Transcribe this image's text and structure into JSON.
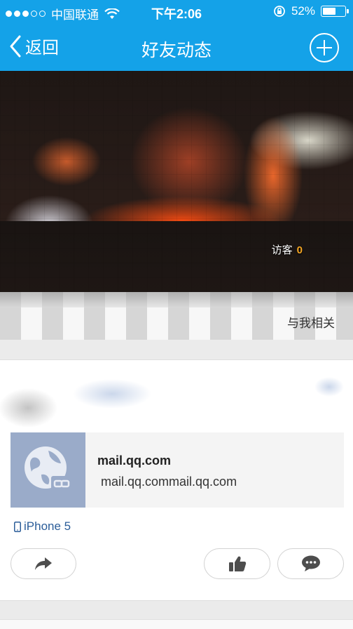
{
  "status_bar": {
    "carrier": "中国联通",
    "time": "下午2:06",
    "battery": "52%",
    "signal_dots_filled": 3,
    "signal_dots_total": 5
  },
  "nav": {
    "back_label": "返回",
    "title": "好友动态",
    "add_icon": "plus-circle-icon"
  },
  "cover": {
    "visitor_label": "访客",
    "visitor_count": "0"
  },
  "subbar": {
    "relation_text": "与我相关"
  },
  "post": {
    "link_title": "mail.qq.com",
    "link_desc": "mail.qq.commail.qq.com",
    "link_icon": "globe-link-icon",
    "device": "iPhone 5",
    "device_icon": "phone-icon",
    "actions": {
      "share_icon": "share-icon",
      "like_icon": "thumbs-up-icon",
      "comment_icon": "comment-icon"
    }
  },
  "colors": {
    "accent": "#14a2e8",
    "link_blue": "#2b5d99",
    "visitor_count": "#f5a623"
  }
}
